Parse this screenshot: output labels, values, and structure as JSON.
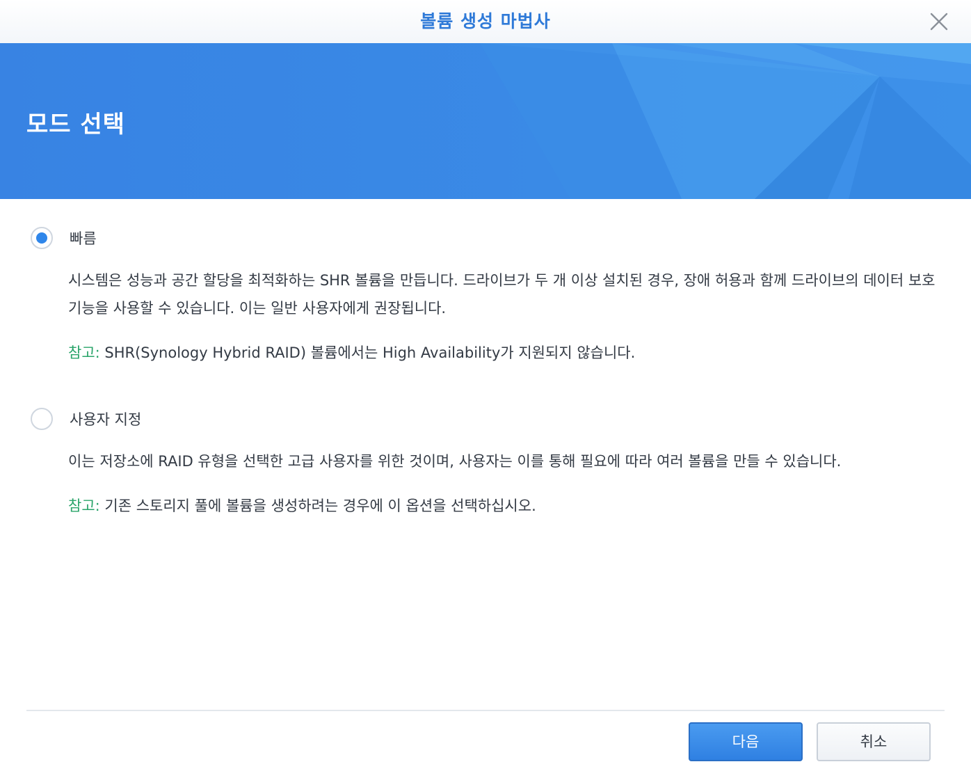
{
  "window": {
    "title": "볼륨 생성 마법사"
  },
  "banner": {
    "heading": "모드 선택"
  },
  "options": [
    {
      "label": "빠름",
      "selected": true,
      "description": "시스템은 성능과 공간 할당을 최적화하는 SHR 볼륨을 만듭니다. 드라이브가 두 개 이상 설치된 경우, 장애 허용과 함께 드라이브의 데이터 보호 기능을 사용할 수 있습니다. 이는 일반 사용자에게 권장됩니다.",
      "note_label": "참고:",
      "note_text": " SHR(Synology Hybrid RAID) 볼륨에서는 High Availability가 지원되지 않습니다."
    },
    {
      "label": "사용자 지정",
      "selected": false,
      "description": "이는 저장소에 RAID 유형을 선택한 고급 사용자를 위한 것이며, 사용자는 이를 통해 필요에 따라 여러 볼륨을 만들 수 있습니다.",
      "note_label": "참고:",
      "note_text": " 기존 스토리지 풀에 볼륨을 생성하려는 경우에 이 옵션을 선택하십시오."
    }
  ],
  "footer": {
    "next_label": "다음",
    "cancel_label": "취소"
  },
  "colors": {
    "accent": "#2f86ea",
    "title": "#2f7ad8",
    "note": "#2aa46a",
    "banner": "#3a87e5"
  },
  "icons": {
    "close": "close-icon"
  }
}
